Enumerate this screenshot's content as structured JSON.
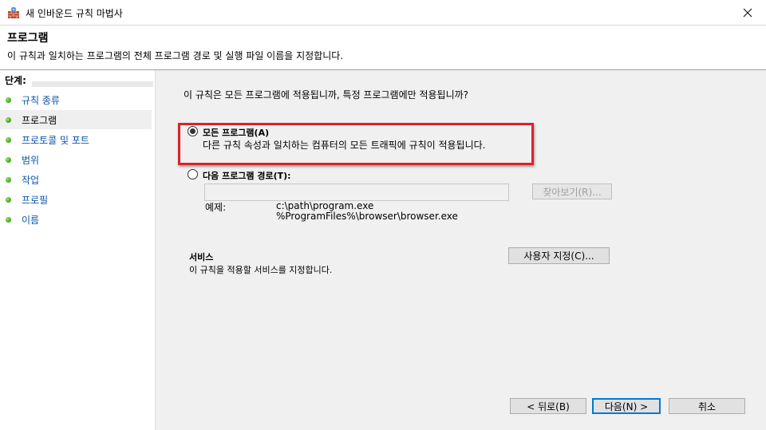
{
  "window": {
    "title": "새 인바운드 규칙 마법사"
  },
  "header": {
    "title": "프로그램",
    "description": "이 규칙과 일치하는 프로그램의 전체 프로그램 경로 및 실행 파일 이름을 지정합니다."
  },
  "steps": {
    "label": "단계:",
    "items": [
      {
        "label": "규칙 종류"
      },
      {
        "label": "프로그램"
      },
      {
        "label": "프로토콜 및 포트"
      },
      {
        "label": "범위"
      },
      {
        "label": "작업"
      },
      {
        "label": "프로필"
      },
      {
        "label": "이름"
      }
    ]
  },
  "main": {
    "question": "이 규칙은 모든 프로그램에 적용됩니까, 특정 프로그램에만 적용됩니까?",
    "option_all": {
      "label": "모든 프로그램(A)",
      "description": "다른 규칙 속성과 일치하는 컴퓨터의 모든 트래픽에 규칙이 적용됩니다.",
      "selected": true
    },
    "option_path": {
      "label": "다음 프로그램 경로(T):",
      "selected": false
    },
    "path_value": "",
    "browse_button": "찾아보기(R)...",
    "example_label": "예제:",
    "example_lines": [
      "c:\\path\\program.exe",
      "%ProgramFiles%\\browser\\browser.exe"
    ],
    "services_title": "서비스",
    "services_desc": "이 규칙을 적용할 서비스를 지정합니다.",
    "customize_button": "사용자 지정(C)..."
  },
  "footer": {
    "back": "< 뒤로(B)",
    "next": "다음(N) >",
    "cancel": "취소"
  },
  "colors": {
    "highlight": "#d8232a",
    "link": "#0a55a8",
    "accent": "#0078d7"
  }
}
